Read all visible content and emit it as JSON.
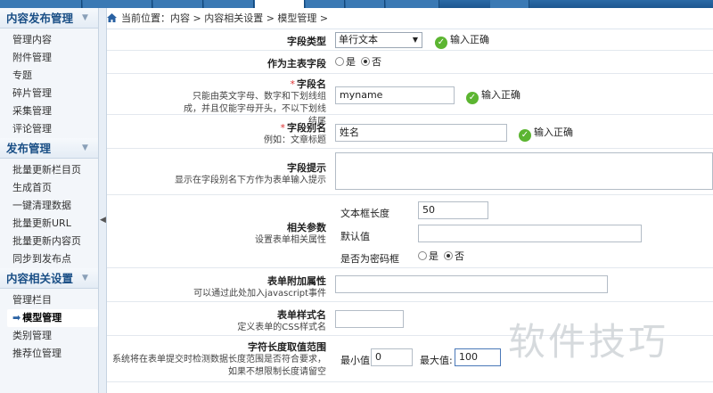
{
  "topnav": {
    "tabs": [
      "",
      "",
      "",
      "",
      "",
      "",
      "",
      "",
      ""
    ],
    "active_index": 4
  },
  "sidebar": {
    "sections": [
      {
        "title": "内容发布管理",
        "items": [
          "管理内容",
          "附件管理",
          "专题",
          "碎片管理",
          "采集管理",
          "评论管理"
        ]
      },
      {
        "title": "发布管理",
        "items": [
          "批量更新栏目页",
          "生成首页",
          "一键清理数据",
          "批量更新URL",
          "批量更新内容页",
          "同步到发布点"
        ]
      },
      {
        "title": "内容相关设置",
        "items": [
          "管理栏目",
          "模型管理",
          "类别管理",
          "推荐位管理"
        ]
      }
    ],
    "active_item": "模型管理",
    "active_arrow": "➡"
  },
  "breadcrumb": {
    "prefix": "当前位置：",
    "path": "内容 > 内容相关设置 > 模型管理 >"
  },
  "form": {
    "field_type": {
      "label": "字段类型",
      "value": "单行文本",
      "status": "输入正确"
    },
    "primary_field": {
      "label": "作为主表字段",
      "opt_yes": "是",
      "opt_no": "否",
      "selected": "否"
    },
    "field_name": {
      "required": "*",
      "label": "字段名",
      "desc": "只能由英文字母、数字和下划线组成，并且仅能字母开头，不以下划线结尾",
      "value": "myname",
      "status": "输入正确"
    },
    "field_alias": {
      "required": "*",
      "label": "字段别名",
      "desc": "例如：文章标题",
      "value": "姓名",
      "status": "输入正确"
    },
    "field_tip": {
      "label": "字段提示",
      "desc": "显示在字段别名下方作为表单输入提示",
      "value": ""
    },
    "params": {
      "label": "相关参数",
      "desc": "设置表单相关属性",
      "size_label": "文本框长度",
      "size_value": "50",
      "default_label": "默认值",
      "default_value": "",
      "password_label": "是否为密码框",
      "opt_yes": "是",
      "opt_no": "否",
      "selected": "否"
    },
    "form_attr": {
      "label": "表单附加属性",
      "desc": "可以通过此处加入javascript事件",
      "value": ""
    },
    "css": {
      "label": "表单样式名",
      "desc": "定义表单的CSS样式名",
      "value": ""
    },
    "length_range": {
      "label": "字符长度取值范围",
      "desc": "系统将在表单提交时检测数据长度范围是否符合要求，如果不想限制长度请留空",
      "min_label": "最小值:",
      "min_value": "0",
      "max_label": "最大值:",
      "max_value": "100"
    }
  },
  "watermark": "软件技巧",
  "colors": {
    "accent": "#1d5790",
    "ok_green": "#5cb531",
    "required_red": "#d33333"
  }
}
